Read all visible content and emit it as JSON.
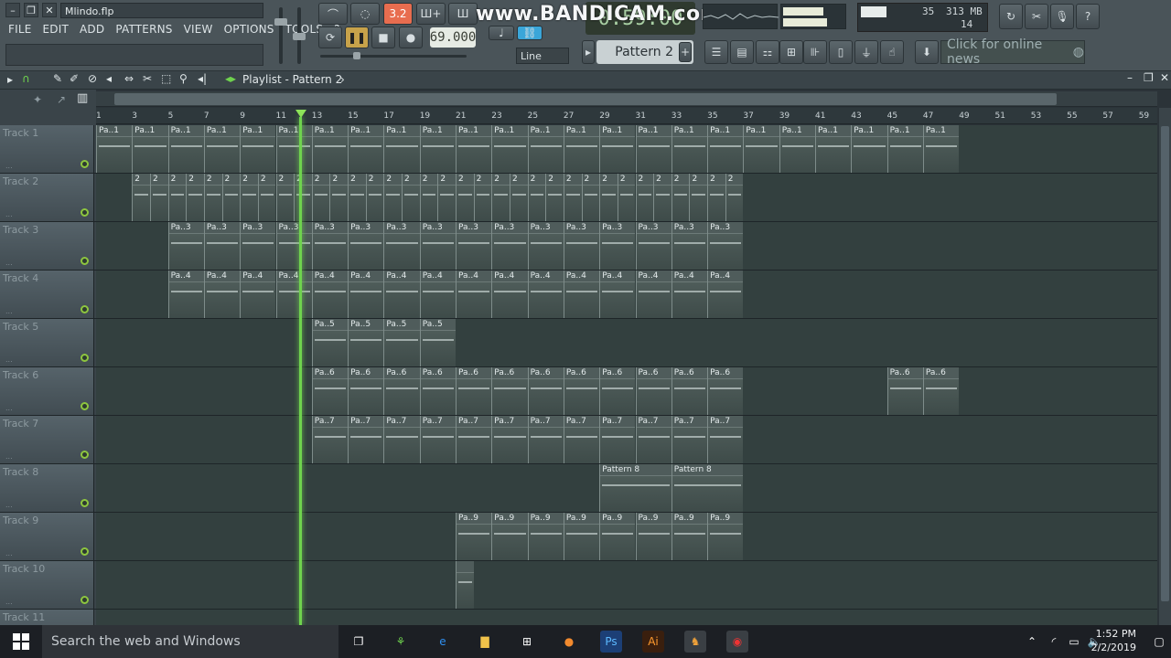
{
  "window": {
    "file_name": "Mlindo.flp"
  },
  "menu": [
    "FILE",
    "EDIT",
    "ADD",
    "PATTERNS",
    "VIEW",
    "OPTIONS",
    "TOOLS",
    "?"
  ],
  "transport": {
    "tempo": "69.000",
    "time_display": "0:59:00",
    "snap_mode": "Line",
    "pattern_selector": "Pattern 2"
  },
  "watermark": "www.BANDICAM.com",
  "monitor": {
    "cpu_value": "35",
    "memory": "313 MB",
    "polyphony": "14"
  },
  "news": {
    "label": "Click for online news"
  },
  "playlist": {
    "title": "Playlist - Pattern 2",
    "ruler_ticks": [
      "1",
      "3",
      "5",
      "7",
      "9",
      "11",
      "13",
      "15",
      "17",
      "19",
      "21",
      "23",
      "25",
      "27",
      "29",
      "31",
      "33",
      "35",
      "37",
      "39",
      "41",
      "43",
      "45",
      "47",
      "49",
      "51",
      "53",
      "55",
      "57",
      "59"
    ],
    "tracks": [
      {
        "name": "Track 1",
        "clip_label": "Pa..1"
      },
      {
        "name": "Track 2",
        "clip_label": "2"
      },
      {
        "name": "Track 3",
        "clip_label": "Pa..3"
      },
      {
        "name": "Track 4",
        "clip_label": "Pa..4"
      },
      {
        "name": "Track 5",
        "clip_label": "Pa..5"
      },
      {
        "name": "Track 6",
        "clip_label": "Pa..6"
      },
      {
        "name": "Track 7",
        "clip_label": "Pa..7"
      },
      {
        "name": "Track 8",
        "clip_label": "Pattern 8"
      },
      {
        "name": "Track 9",
        "clip_label": "Pa..9"
      },
      {
        "name": "Track 10",
        "clip_label": ""
      },
      {
        "name": "Track 11",
        "clip_label": ""
      }
    ]
  },
  "taskbar": {
    "search_placeholder": "Search the web and Windows",
    "time": "1:52 PM",
    "date": "2/2/2019"
  },
  "colors": {
    "playhead": "#6fd34e",
    "accent_tempo": "#e86d4f"
  }
}
